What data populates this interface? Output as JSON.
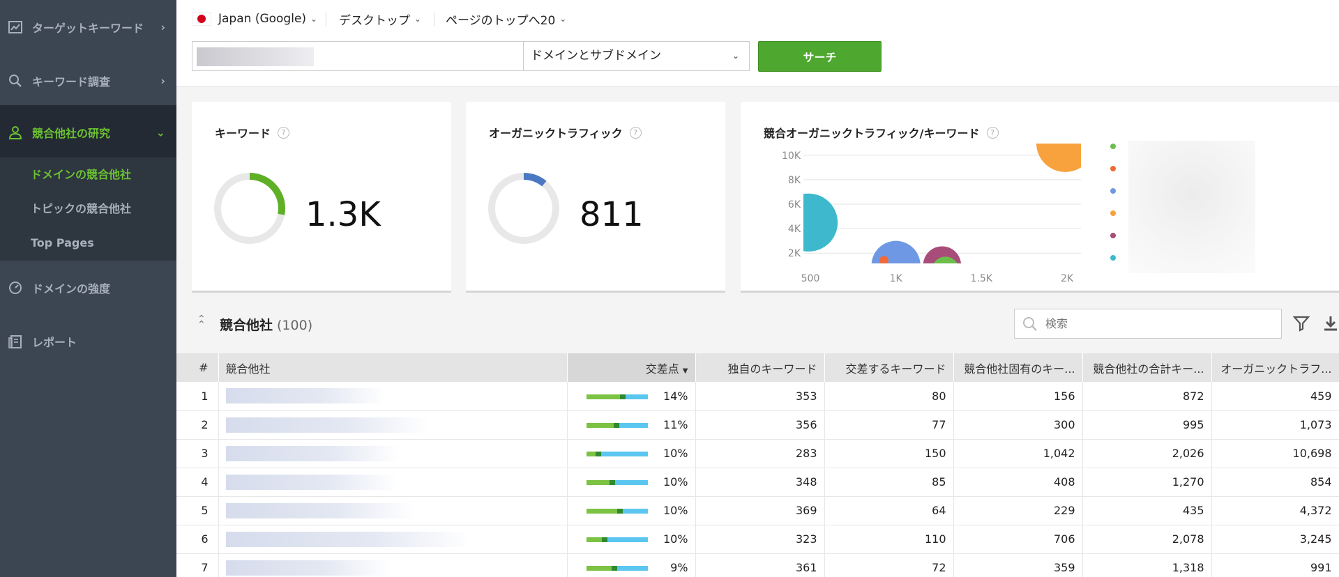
{
  "sidebar": {
    "items": [
      {
        "label": "ターゲットキーワード",
        "icon": "trend-chart-icon"
      },
      {
        "label": "キーワード調査",
        "icon": "search-icon"
      },
      {
        "label": "競合他社の研究",
        "icon": "user-icon"
      },
      {
        "label": "ドメインの強度",
        "icon": "gauge-icon"
      },
      {
        "label": "レポート",
        "icon": "report-icon"
      }
    ],
    "subitems": [
      {
        "label": "ドメインの競合他社"
      },
      {
        "label": "トピックの競合他社"
      },
      {
        "label": "Top Pages"
      }
    ]
  },
  "filters": {
    "region": "Japan (Google)",
    "device": "デスクトップ",
    "position": "ページのトップへ20"
  },
  "search": {
    "scope": "ドメインとサブドメイン",
    "button_label": "サーチ"
  },
  "cards": {
    "keywords": {
      "title": "キーワード",
      "value": "1.3K",
      "fraction": 0.28,
      "color": "#5faf27"
    },
    "traffic": {
      "title": "オーガニックトラフィック",
      "value": "811",
      "fraction": 0.11,
      "color": "#4a78c2"
    },
    "bubble": {
      "title": "競合オーガニックトラフィック/キーワード"
    }
  },
  "chart_data": {
    "type": "scatter",
    "title": "競合オーガニックトラフィック/キーワード",
    "x_ticks": [
      "500",
      "1K",
      "1.5K",
      "2K"
    ],
    "y_ticks": [
      "2K",
      "4K",
      "6K",
      "8K",
      "10K"
    ],
    "xlim": [
      500,
      2000
    ],
    "ylim": [
      1500,
      10500
    ],
    "grid": true,
    "points": [
      {
        "x": 1990,
        "y": 11000,
        "color": "#f7a23c",
        "size": 32
      },
      {
        "x": 490,
        "y": 4500,
        "color": "#3db8cc",
        "size": 32
      },
      {
        "x": 1000,
        "y": 1000,
        "color": "#6f98e4",
        "size": 27
      },
      {
        "x": 1270,
        "y": 1000,
        "color": "#a84d79",
        "size": 21
      },
      {
        "x": 1290,
        "y": 600,
        "color": "#6cbf4b",
        "size": 15
      },
      {
        "x": 930,
        "y": 1400,
        "color": "#ef6a37",
        "size": 5
      }
    ],
    "legend_colors": [
      "#6cbf4b",
      "#ef6a37",
      "#6f98e4",
      "#f7a23c",
      "#a84d79",
      "#3db8cc"
    ]
  },
  "competitors": {
    "title": "競合他社",
    "count": "(100)",
    "search_placeholder": "検索",
    "columns": [
      "#",
      "競合他社",
      "交差点",
      "独自のキーワード",
      "交差するキーワード",
      "競合他社固有のキー...",
      "競合他社の合計キー...",
      "オーガニックトラフ..."
    ],
    "rows": [
      {
        "idx": "1",
        "pct": "14%",
        "green": 0.55,
        "unique": "353",
        "cross": "80",
        "comp_unique": "156",
        "comp_total": "872",
        "traffic": "459"
      },
      {
        "idx": "2",
        "pct": "11%",
        "green": 0.45,
        "unique": "356",
        "cross": "77",
        "comp_unique": "300",
        "comp_total": "995",
        "traffic": "1,073"
      },
      {
        "idx": "3",
        "pct": "10%",
        "green": 0.15,
        "unique": "283",
        "cross": "150",
        "comp_unique": "1,042",
        "comp_total": "2,026",
        "traffic": "10,698"
      },
      {
        "idx": "4",
        "pct": "10%",
        "green": 0.38,
        "unique": "348",
        "cross": "85",
        "comp_unique": "408",
        "comp_total": "1,270",
        "traffic": "854"
      },
      {
        "idx": "5",
        "pct": "10%",
        "green": 0.5,
        "unique": "369",
        "cross": "64",
        "comp_unique": "229",
        "comp_total": "435",
        "traffic": "4,372"
      },
      {
        "idx": "6",
        "pct": "10%",
        "green": 0.25,
        "unique": "323",
        "cross": "110",
        "comp_unique": "706",
        "comp_total": "2,078",
        "traffic": "3,245"
      },
      {
        "idx": "7",
        "pct": "9%",
        "green": 0.42,
        "unique": "361",
        "cross": "72",
        "comp_unique": "359",
        "comp_total": "1,318",
        "traffic": "991"
      }
    ]
  }
}
